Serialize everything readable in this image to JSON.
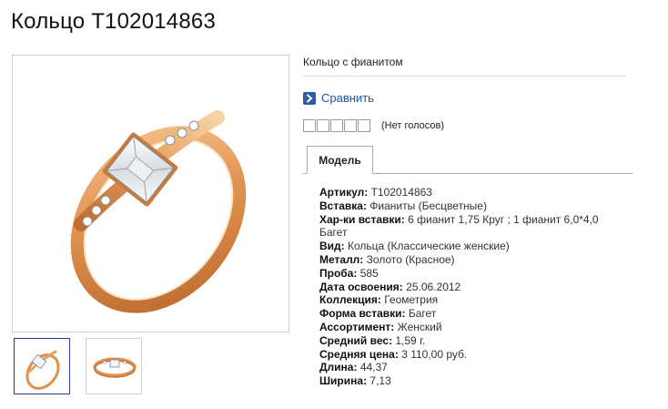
{
  "page": {
    "title": "Кольцо Т102014863"
  },
  "product": {
    "short_description": "Кольцо с фианитом",
    "compare_label": "Сравнить",
    "rating": {
      "stars_total": 5,
      "stars_filled": 0,
      "votes_text": "(Нет голосов)"
    },
    "tabs": [
      {
        "label": "Модель",
        "active": true
      }
    ],
    "specs": [
      {
        "key": "Артикул:",
        "value": "Т102014863"
      },
      {
        "key": "Вставка:",
        "value": "Фианиты (Бесцветные)"
      },
      {
        "key": "Хар-ки вставки:",
        "value": "6 фианит 1,75 Круг ; 1 фианит 6,0*4,0 Багет"
      },
      {
        "key": "Вид:",
        "value": "Кольца (Классические женские)"
      },
      {
        "key": "Металл:",
        "value": "Золото (Красное)"
      },
      {
        "key": "Проба:",
        "value": "585"
      },
      {
        "key": "Дата освоения:",
        "value": "25.06.2012"
      },
      {
        "key": "Коллекция:",
        "value": "Геометрия"
      },
      {
        "key": "Форма вставки:",
        "value": "Багет"
      },
      {
        "key": "Ассортимент:",
        "value": "Женский"
      },
      {
        "key": "Средний вес:",
        "value": "1,59 г."
      },
      {
        "key": "Средняя цена:",
        "value": "3 110,00 руб."
      },
      {
        "key": "Длина:",
        "value": "44,37"
      },
      {
        "key": "Ширина:",
        "value": "7,13"
      }
    ]
  },
  "gallery": {
    "main_image": "ring-photo-front",
    "thumbnails": [
      {
        "image": "ring-photo-front",
        "active": true
      },
      {
        "image": "ring-photo-side",
        "active": false
      }
    ]
  },
  "colors": {
    "gold": "#d9894a",
    "gold_light": "#f1c08a",
    "gold_dark": "#a85a25",
    "link_blue": "#1f56a8",
    "icon_blue": "#2d5da8",
    "active_thumb_border": "#2a3d9a"
  },
  "icons": {
    "compare": "chevron-right-icon"
  }
}
